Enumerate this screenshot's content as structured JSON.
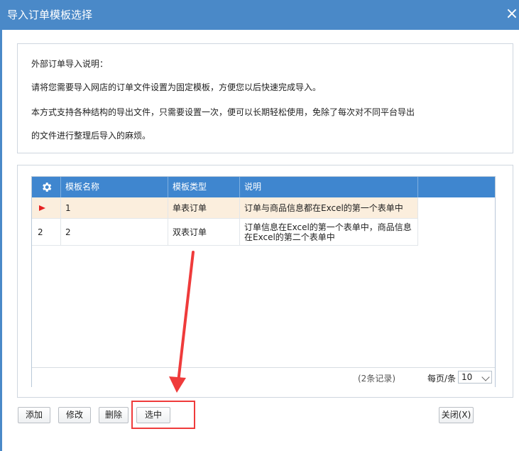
{
  "window": {
    "title": "导入订单模板选择",
    "close_symbol": "×"
  },
  "description": {
    "lines": [
      "外部订单导入说明：",
      "请将您需要导入网店的订单文件设置为固定模板，方便您以后快速完成导入。",
      "本方式支持各种结构的导出文件，只需要设置一次，便可以长期轻松使用，免除了每次对不同平台导出",
      "的文件进行整理后导入的麻烦。"
    ]
  },
  "grid": {
    "settings_icon": "gear-icon",
    "headers": [
      "模板名称",
      "模板类型",
      "说明"
    ],
    "rows": [
      {
        "row_no": "",
        "name": "1",
        "type": "单表订单",
        "desc": "订单与商品信息都在Excel的第一个表单中",
        "selected": true
      },
      {
        "row_no": "2",
        "name": "2",
        "type": "双表订单",
        "desc": "订单信息在Excel的第一个表单中，商品信息在Excel的第二个表单中",
        "selected": false
      }
    ],
    "pager": {
      "record_count": "(2条记录)",
      "per_page_label": "每页/条",
      "per_page_value": "10"
    }
  },
  "buttons": {
    "add": "添加",
    "edit": "修改",
    "delete": "删除",
    "select": "选中",
    "close": "关闭(X)"
  },
  "colors": {
    "titlebar": "#4a89c8",
    "grid_header": "#3f86cf",
    "selected_row": "#fbeedd",
    "annotation": "#ef3b3b"
  }
}
